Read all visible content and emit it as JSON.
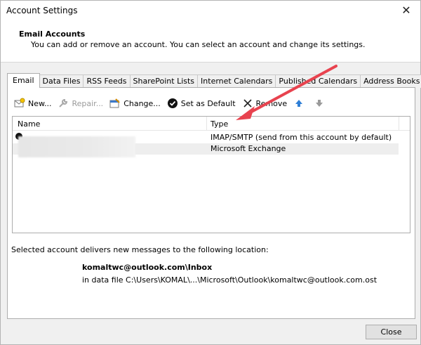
{
  "window": {
    "title": "Account Settings",
    "close_glyph": "✕"
  },
  "header": {
    "title": "Email Accounts",
    "description": "You can add or remove an account. You can select an account and change its settings."
  },
  "tabs": [
    {
      "label": "Email",
      "active": true
    },
    {
      "label": "Data Files"
    },
    {
      "label": "RSS Feeds"
    },
    {
      "label": "SharePoint Lists"
    },
    {
      "label": "Internet Calendars"
    },
    {
      "label": "Published Calendars"
    },
    {
      "label": "Address Books"
    }
  ],
  "toolbar": {
    "new_label": "New...",
    "repair_label": "Repair...",
    "change_label": "Change...",
    "set_default_label": "Set as Default",
    "remove_label": "Remove"
  },
  "accounts_table": {
    "columns": {
      "name": "Name",
      "type": "Type"
    },
    "rows": [
      {
        "type": "IMAP/SMTP (send from this account by default)"
      },
      {
        "type": "Microsoft Exchange"
      }
    ]
  },
  "location": {
    "label": "Selected account delivers new messages to the following location:",
    "folder": "komaltwc@outlook.com\\Inbox",
    "path": "in data file C:\\Users\\KOMAL\\...\\Microsoft\\Outlook\\komaltwc@outlook.com.ost"
  },
  "buttons": {
    "close_label": "Close"
  },
  "colors": {
    "annotation_arrow": "#e8434f"
  }
}
